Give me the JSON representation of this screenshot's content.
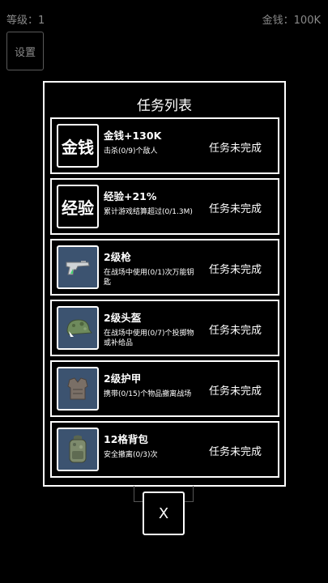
{
  "hud": {
    "level_text": "等级：1",
    "money_text": "金钱：100K"
  },
  "settings_label": "设置",
  "dialog": {
    "title": "任务列表",
    "tasks": [
      {
        "icon_text": "金钱",
        "icon": "money-text-icon",
        "name": "金钱+130K",
        "desc": "击杀(0/9)个敌人",
        "status": "任务未完成"
      },
      {
        "icon_text": "经验",
        "icon": "exp-text-icon",
        "name": "经验+21%",
        "desc": "累计游戏结算超过(0/1.3M)",
        "status": "任务未完成"
      },
      {
        "icon": "pistol-icon",
        "name": "2级枪",
        "desc": "在战场中使用(0/1)次万能钥匙",
        "status": "任务未完成"
      },
      {
        "icon": "helmet-icon",
        "name": "2级头盔",
        "desc": "在战场中使用(0/7)个投掷物或补给品",
        "status": "任务未完成"
      },
      {
        "icon": "armor-icon",
        "name": "2级护甲",
        "desc": "携带(0/15)个物品撤离战场",
        "status": "任务未完成"
      },
      {
        "icon": "backpack-icon",
        "name": "12格背包",
        "desc": "安全撤离(0/3)次",
        "status": "任务未完成"
      }
    ]
  },
  "close_label": "X",
  "colors": {
    "background": "#000000",
    "hud_text": "#8a8a8a",
    "item_icon_bg": "#3c5370"
  }
}
